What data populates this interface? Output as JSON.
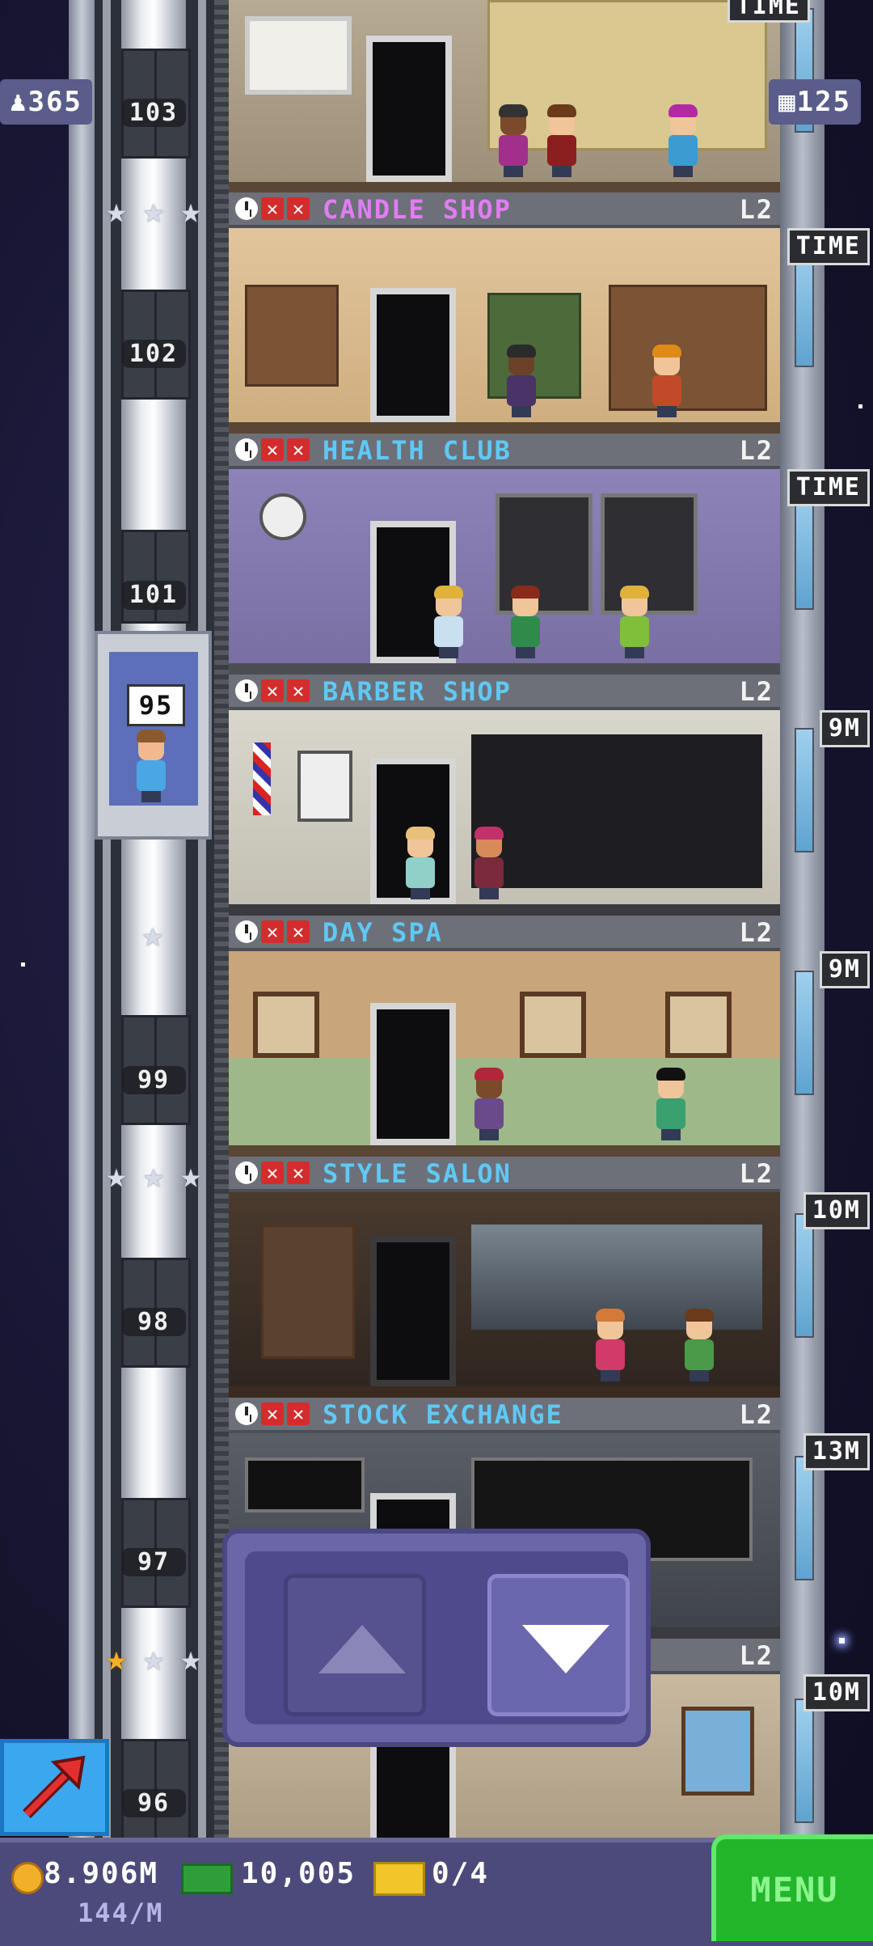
{
  "hud": {
    "population": "365",
    "floors": "125"
  },
  "elevator": {
    "current_floor": "95"
  },
  "shaft_numbers": [
    "103",
    "102",
    "101",
    "99",
    "98",
    "97",
    "96"
  ],
  "floors": [
    {
      "name": "CANDLE SHOP",
      "level": "L2",
      "tag": "TIME",
      "name_color": "#e17df2"
    },
    {
      "name": "HEALTH CLUB",
      "level": "L2",
      "tag": "TIME",
      "name_color": "#5fc9f5"
    },
    {
      "name": "BARBER SHOP",
      "level": "L2",
      "tag": "9M",
      "name_color": "#5fc9f5"
    },
    {
      "name": "DAY SPA",
      "level": "L2",
      "tag": "9M",
      "name_color": "#5fc9f5"
    },
    {
      "name": "STYLE SALON",
      "level": "L2",
      "tag": "10M",
      "name_color": "#5fc9f5"
    },
    {
      "name": "STOCK EXCHANGE",
      "level": "L2",
      "tag": "13M",
      "name_color": "#5fc9f5"
    },
    {
      "name": "",
      "level": "L2",
      "tag": "10M",
      "name_color": "#5fc9f5"
    }
  ],
  "top_floor_tag": "TIME",
  "status": {
    "coins": "8.906M",
    "bux": "10,005",
    "tickets": "0/4",
    "rate": "144/M"
  },
  "menu_label": "MENU",
  "icons": {
    "population": "person-icon",
    "floors": "building-icon",
    "coin": "coin-icon",
    "bux": "bux-icon",
    "ticket": "ticket-icon",
    "share": "share-arrow-icon"
  }
}
